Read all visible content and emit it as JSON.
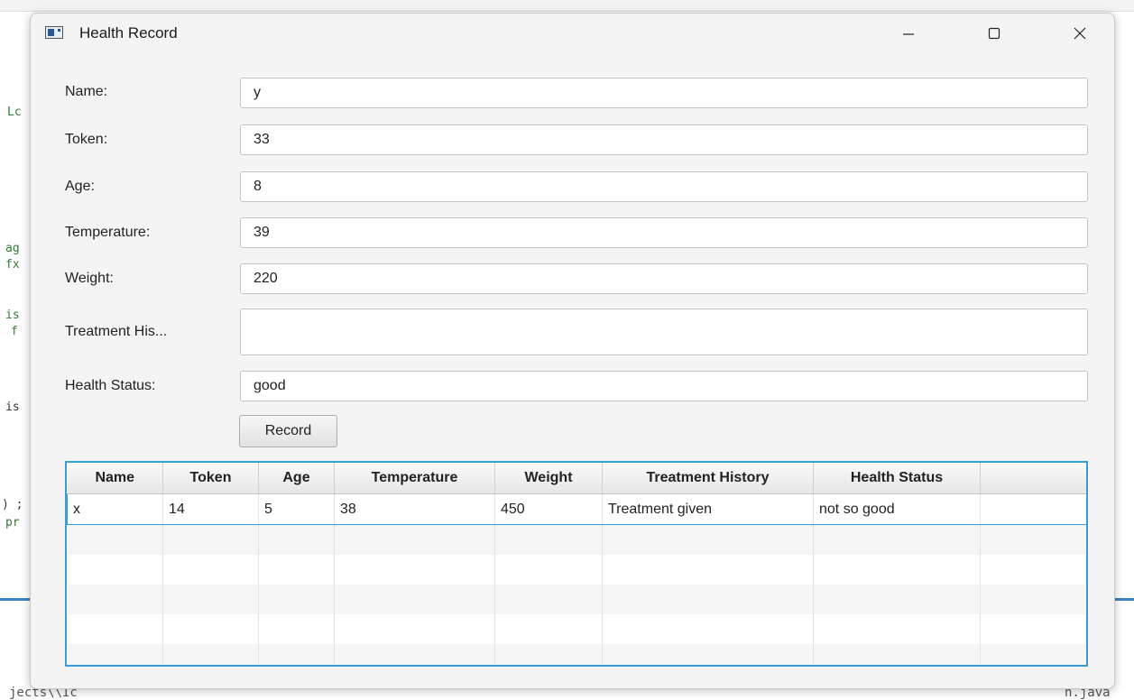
{
  "window": {
    "title": "Health Record",
    "icon": "app-window-icon"
  },
  "form": {
    "name_label": "Name:",
    "name_value": "y",
    "token_label": "Token:",
    "token_value": "33",
    "age_label": "Age:",
    "age_value": "8",
    "temperature_label": "Temperature:",
    "temperature_value": "39",
    "weight_label": "Weight:",
    "weight_value": "220",
    "treatment_label": "Treatment His...",
    "treatment_value": "",
    "health_label": "Health Status:",
    "health_value": "good",
    "record_button": "Record"
  },
  "table": {
    "columns": [
      "Name",
      "Token",
      "Age",
      "Temperature",
      "Weight",
      "Treatment History",
      "Health Status",
      ""
    ],
    "rows": [
      [
        "x",
        "14",
        "5",
        "38",
        "450",
        "Treatment given",
        "not so good",
        ""
      ]
    ]
  },
  "background": {
    "code_fragments": [
      "Lc",
      "ag",
      "fx",
      "is",
      "f",
      "is",
      ") ;",
      "pr"
    ],
    "bottom_left": "jects\\\\Ic",
    "bottom_right": "n.java"
  },
  "colors": {
    "accent": "#3a9bd9",
    "ide_line": "#3b82c4"
  }
}
